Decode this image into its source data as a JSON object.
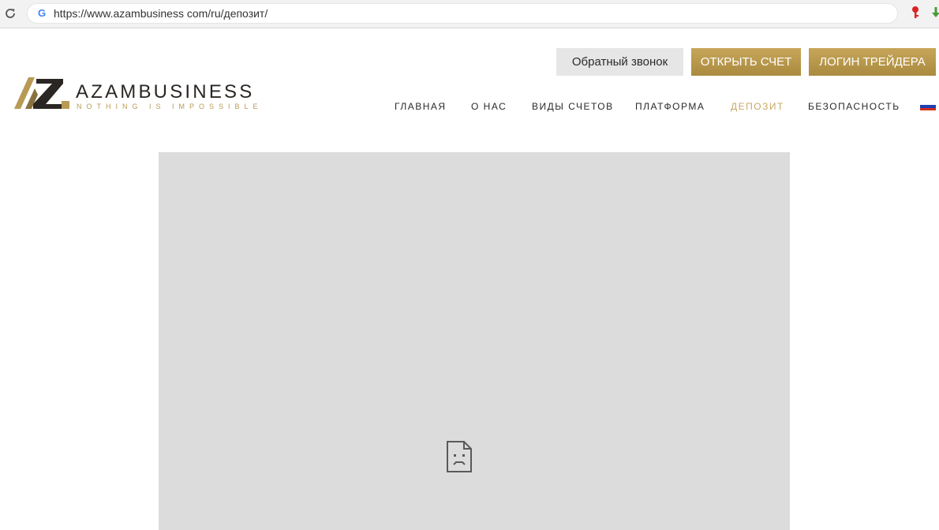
{
  "browser": {
    "url": "https://www.azambusiness com/ru/депозит/",
    "icons": {
      "reload": "reload-icon",
      "site": "google-g-icon",
      "extensions": [
        "key-icon",
        "download-arrow-icon"
      ]
    }
  },
  "header": {
    "logo": {
      "name": "AZAMBUSINESS",
      "tagline": "NOTHING IS IMPOSSIBLE",
      "colors": {
        "dark": "#2a2623",
        "gold": "#b89a55"
      }
    },
    "buttons": {
      "callback": "Обратный звонок",
      "open_account": "ОТКРЫТЬ СЧЕТ",
      "trader_login": "ЛОГИН ТРЕЙДЕРА"
    },
    "nav": [
      {
        "label": "ГЛАВНАЯ",
        "active": false
      },
      {
        "label": "О НАС",
        "active": false
      },
      {
        "label": "ВИДЫ СЧЕТОВ",
        "active": false
      },
      {
        "label": "ПЛАТФОРМА",
        "active": false
      },
      {
        "label": "ДЕПОЗИТ",
        "active": true
      },
      {
        "label": "БЕЗОПАСНОСТЬ",
        "active": false
      }
    ],
    "language_flag": "russian-flag-icon"
  },
  "main": {
    "embedded_frame": {
      "state": "failed to load",
      "icon": "sad-document-icon"
    }
  },
  "colors": {
    "accent_gold": "#c8a864",
    "button_gold": "#b6964a",
    "button_grey": "#e6e6e6",
    "frame_grey": "#dcdcdc"
  }
}
